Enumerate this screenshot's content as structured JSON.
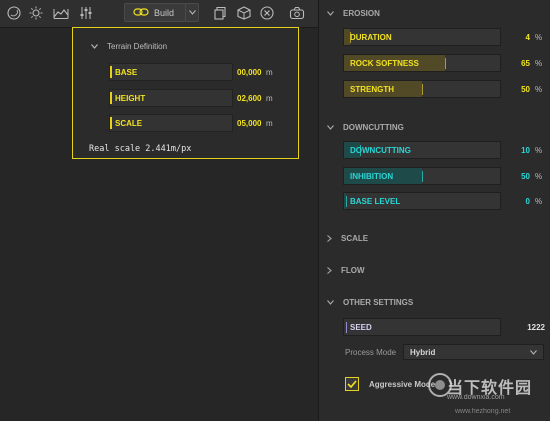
{
  "toolbar": {
    "icons": [
      "moon-icon",
      "sun-icon",
      "terrain-profile-icon",
      "sliders-icon",
      "chain-link-icon",
      "copy-icon",
      "cube-icon",
      "close-circle-icon",
      "camera-icon"
    ],
    "build_label": "Build"
  },
  "terrain": {
    "title": "Terrain Definition",
    "rows": [
      {
        "label": "BASE",
        "value": "00,000",
        "unit": "m"
      },
      {
        "label": "HEIGHT",
        "value": "02,600",
        "unit": "m"
      },
      {
        "label": "SCALE",
        "value": "05,000",
        "unit": "m"
      }
    ],
    "real_scale": "Real scale 2.441m/px"
  },
  "panel": {
    "erosion": {
      "title": "EROSION",
      "items": [
        {
          "label": "DURATION",
          "value": "4",
          "unit": "%",
          "level": 0.04
        },
        {
          "label": "ROCK SOFTNESS",
          "value": "65",
          "unit": "%",
          "level": 0.65
        },
        {
          "label": "STRENGTH",
          "value": "50",
          "unit": "%",
          "level": 0.5
        }
      ]
    },
    "downcutting": {
      "title": "DOWNCUTTING",
      "items": [
        {
          "label": "DOWNCUTTING",
          "value": "10",
          "unit": "%",
          "level": 0.1
        },
        {
          "label": "INHIBITION",
          "value": "50",
          "unit": "%",
          "level": 0.5
        },
        {
          "label": "BASE LEVEL",
          "value": "0",
          "unit": "%",
          "level": 0
        }
      ]
    },
    "scale": {
      "title": "SCALE"
    },
    "flow": {
      "title": "FLOW"
    },
    "other": {
      "title": "OTHER SETTINGS",
      "seed_label": "SEED",
      "seed_value": "1222",
      "process_mode_label": "Process Mode",
      "process_mode_value": "Hybrid",
      "aggressive_label": "Aggressive Mode",
      "aggressive_checked": true
    }
  },
  "watermark": {
    "cn": "当下软件园",
    "url1": "www.downxia.com",
    "url2": "www.hezhong.net"
  },
  "colors": {
    "accent_yellow": "#f2e31f",
    "accent_cyan": "#29d6d6",
    "accent_violet": "#9a8ad0"
  }
}
